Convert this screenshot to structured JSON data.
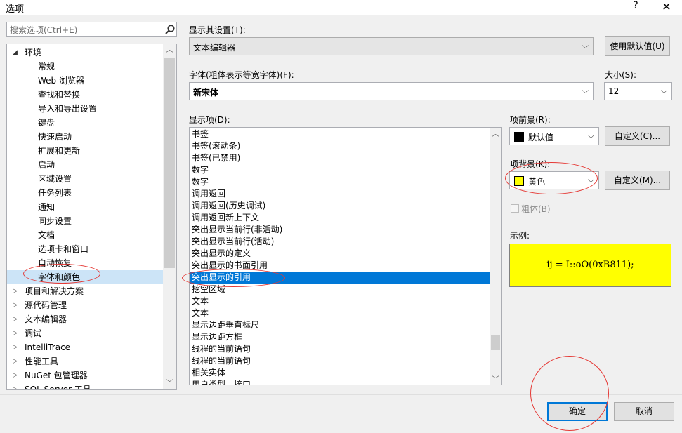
{
  "window": {
    "title": "选项",
    "help_label": "?",
    "close_label": "✕"
  },
  "search": {
    "placeholder": "搜索选项(Ctrl+E)"
  },
  "tree": {
    "items": [
      {
        "label": "环境",
        "toggle": "◢",
        "level": 0,
        "selected": false
      },
      {
        "label": "常规",
        "toggle": "",
        "level": 1,
        "selected": false
      },
      {
        "label": "Web 浏览器",
        "toggle": "",
        "level": 1,
        "selected": false
      },
      {
        "label": "查找和替换",
        "toggle": "",
        "level": 1,
        "selected": false
      },
      {
        "label": "导入和导出设置",
        "toggle": "",
        "level": 1,
        "selected": false
      },
      {
        "label": "键盘",
        "toggle": "",
        "level": 1,
        "selected": false
      },
      {
        "label": "快速启动",
        "toggle": "",
        "level": 1,
        "selected": false
      },
      {
        "label": "扩展和更新",
        "toggle": "",
        "level": 1,
        "selected": false
      },
      {
        "label": "启动",
        "toggle": "",
        "level": 1,
        "selected": false
      },
      {
        "label": "区域设置",
        "toggle": "",
        "level": 1,
        "selected": false
      },
      {
        "label": "任务列表",
        "toggle": "",
        "level": 1,
        "selected": false
      },
      {
        "label": "通知",
        "toggle": "",
        "level": 1,
        "selected": false
      },
      {
        "label": "同步设置",
        "toggle": "",
        "level": 1,
        "selected": false
      },
      {
        "label": "文档",
        "toggle": "",
        "level": 1,
        "selected": false
      },
      {
        "label": "选项卡和窗口",
        "toggle": "",
        "level": 1,
        "selected": false
      },
      {
        "label": "自动恢复",
        "toggle": "",
        "level": 1,
        "selected": false
      },
      {
        "label": "字体和颜色",
        "toggle": "",
        "level": 1,
        "selected": true
      },
      {
        "label": "项目和解决方案",
        "toggle": "▷",
        "level": 0,
        "selected": false
      },
      {
        "label": "源代码管理",
        "toggle": "▷",
        "level": 0,
        "selected": false
      },
      {
        "label": "文本编辑器",
        "toggle": "▷",
        "level": 0,
        "selected": false
      },
      {
        "label": "调试",
        "toggle": "▷",
        "level": 0,
        "selected": false
      },
      {
        "label": "IntelliTrace",
        "toggle": "▷",
        "level": 0,
        "selected": false
      },
      {
        "label": "性能工具",
        "toggle": "▷",
        "level": 0,
        "selected": false
      },
      {
        "label": "NuGet 包管理器",
        "toggle": "▷",
        "level": 0,
        "selected": false
      },
      {
        "label": "SQL Server 工具",
        "toggle": "▷",
        "level": 0,
        "selected": false
      }
    ]
  },
  "settings_for": {
    "label": "显示其设置(T):",
    "value": "文本编辑器",
    "use_defaults_label": "使用默认值(U)"
  },
  "font": {
    "label": "字体(粗体表示等宽字体)(F):",
    "value": "新宋体"
  },
  "size": {
    "label": "大小(S):",
    "value": "12"
  },
  "display_items": {
    "label": "显示项(D):",
    "items": [
      "书签",
      "书签(滚动条)",
      "书签(已禁用)",
      "数字",
      "数字",
      "调用返回",
      "调用返回(历史调试)",
      "调用返回新上下文",
      "突出显示当前行(非活动)",
      "突出显示当前行(活动)",
      "突出显示的定义",
      "突出显示的书面引用",
      "突出显示的引用",
      "挖空区域",
      "文本",
      "文本",
      "显示边距垂直标尺",
      "显示边距方框",
      "线程的当前语句",
      "线程的当前语句",
      "相关实体",
      "用户类型 - 接口"
    ],
    "selected_index": 12
  },
  "foreground": {
    "label": "项前景(R):",
    "value": "默认值",
    "swatch_color": "#000000",
    "custom_label": "自定义(C)..."
  },
  "background": {
    "label": "项背景(K):",
    "value": "黄色",
    "swatch_color": "#ffff00",
    "custom_label": "自定义(M)..."
  },
  "bold": {
    "label": "粗体(B)",
    "checked": false
  },
  "sample": {
    "label": "示例:",
    "text": "ij = I::oO(0xB811);",
    "background": "#ffff00"
  },
  "footer": {
    "ok_label": "确定",
    "cancel_label": "取消"
  }
}
